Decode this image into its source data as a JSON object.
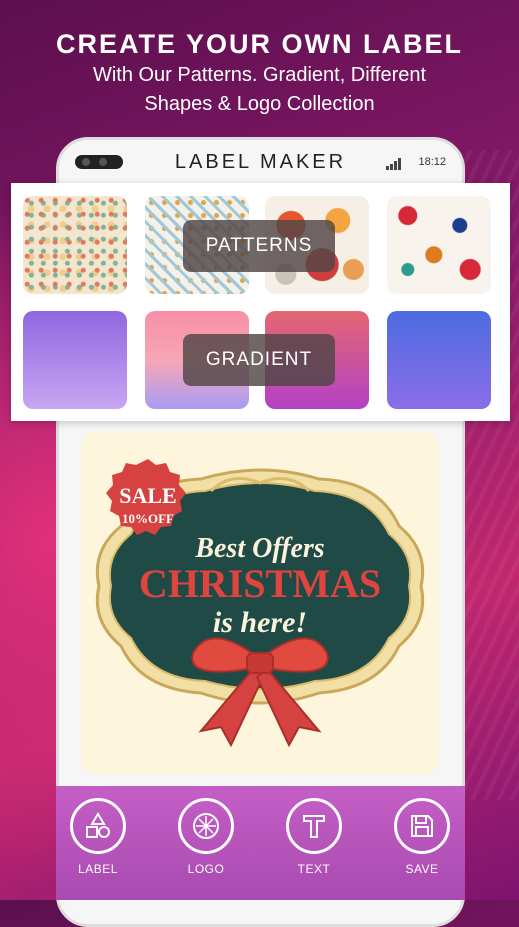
{
  "headline": {
    "title": "CREATE YOUR OWN LABEL",
    "subtitle_line1": "With Our Patterns. Gradient, Different",
    "subtitle_line2": "Shapes & Logo Collection"
  },
  "app": {
    "title": "LABEL MAKER",
    "clock": "18:12"
  },
  "panel": {
    "patterns_label": "PATTERNS",
    "gradient_label": "GRADIENT"
  },
  "poster": {
    "badge_line1": "SALE",
    "badge_line2": "10%OFF",
    "line1": "Best Offers",
    "line2": "CHRISTMAS",
    "line3": "is here!"
  },
  "toolbar": {
    "items": [
      {
        "label": "LABEL",
        "icon": "shapes-icon"
      },
      {
        "label": "LOGO",
        "icon": "logo-icon"
      },
      {
        "label": "TEXT",
        "icon": "text-icon"
      },
      {
        "label": "SAVE",
        "icon": "save-icon"
      }
    ]
  },
  "colors": {
    "background": "#8a1a6b",
    "toolbar": "#b652bb",
    "poster_frame": "#1f4a45",
    "accent_red": "#d6423f"
  }
}
